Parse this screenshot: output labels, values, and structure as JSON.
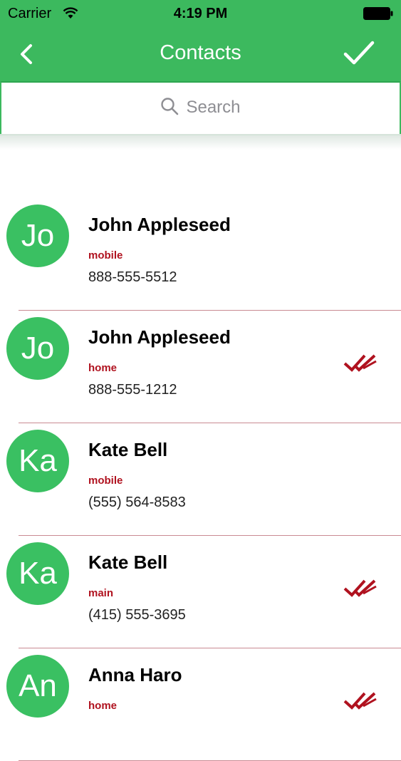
{
  "status_bar": {
    "carrier": "Carrier",
    "time": "4:19 PM"
  },
  "nav": {
    "title": "Contacts",
    "back_icon": "chevron-left-icon",
    "done_icon": "checkmark-icon"
  },
  "search": {
    "placeholder": "Search",
    "icon": "search-icon"
  },
  "colors": {
    "accent": "#3cb95e",
    "label": "#b0121f",
    "separator": "#c98a92"
  },
  "contacts": [
    {
      "initials": "Jo",
      "name": "John Appleseed",
      "label": "mobile",
      "phone": "888-555-5512",
      "selected": false
    },
    {
      "initials": "Jo",
      "name": "John Appleseed",
      "label": "home",
      "phone": "888-555-1212",
      "selected": true
    },
    {
      "initials": "Ka",
      "name": "Kate Bell",
      "label": "mobile",
      "phone": "(555) 564-8583",
      "selected": false
    },
    {
      "initials": "Ka",
      "name": "Kate Bell",
      "label": "main",
      "phone": "(415) 555-3695",
      "selected": true
    },
    {
      "initials": "An",
      "name": "Anna Haro",
      "label": "home",
      "phone": "",
      "selected": true
    }
  ]
}
